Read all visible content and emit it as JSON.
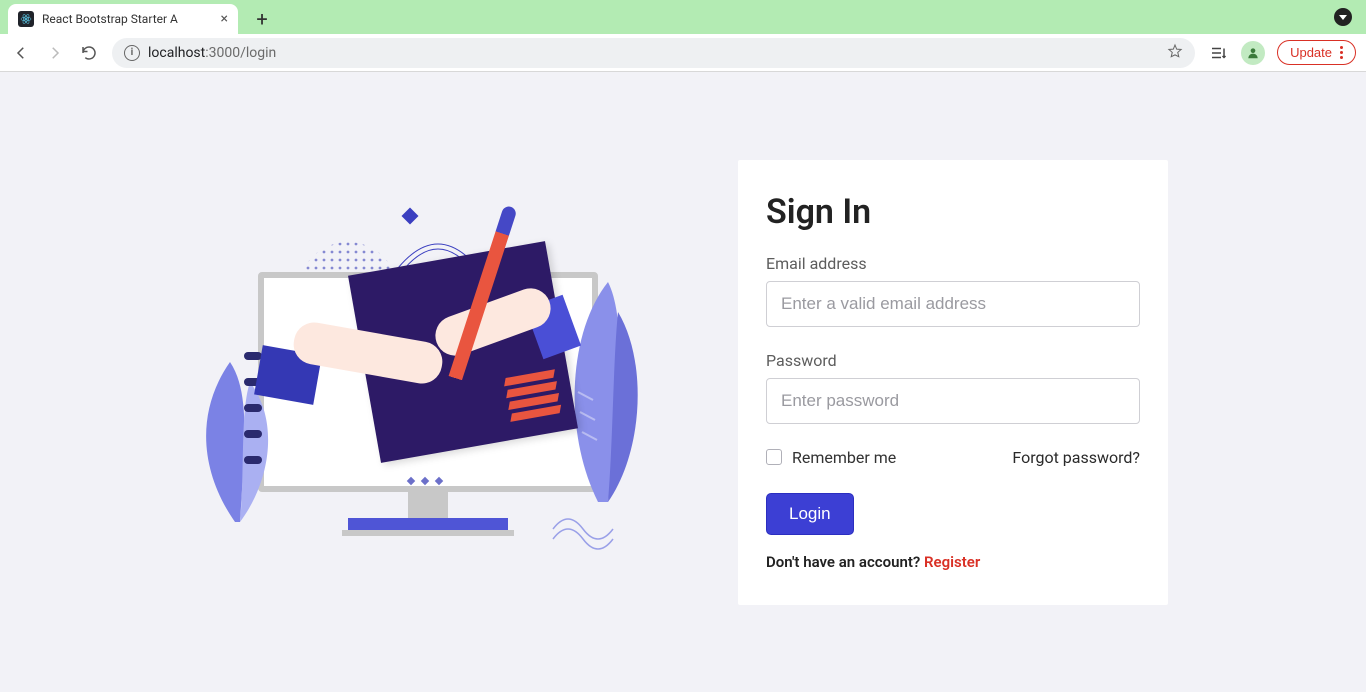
{
  "browser": {
    "tab_title": "React Bootstrap Starter A",
    "url_host": "localhost",
    "url_path": ":3000/login",
    "update_label": "Update"
  },
  "form": {
    "heading": "Sign In",
    "email_label": "Email address",
    "email_placeholder": "Enter a valid email address",
    "password_label": "Password",
    "password_placeholder": "Enter password",
    "remember_label": "Remember me",
    "forgot_label": "Forgot password?",
    "submit_label": "Login",
    "signup_prompt": "Don't have an account? ",
    "signup_link": "Register"
  },
  "colors": {
    "primary": "#3c3fd4",
    "danger": "#d93025",
    "page_bg": "#f2f2f7"
  }
}
